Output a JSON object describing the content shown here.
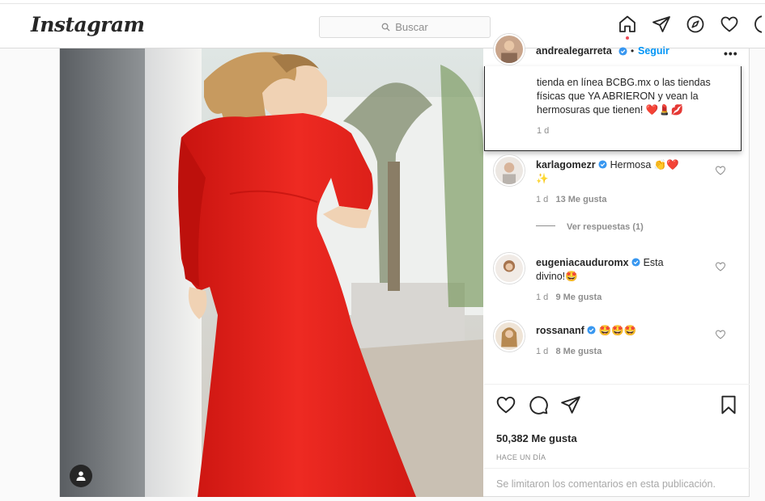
{
  "topbar": {
    "logo": "Instagram",
    "search_placeholder": "Buscar",
    "icons": [
      "home-icon",
      "direct-icon",
      "explore-icon",
      "activity-heart-icon",
      "profile-avatar-icon"
    ]
  },
  "post": {
    "author": "andrealegarreta",
    "follow_label": "Seguir",
    "more_label": "•••",
    "caption_lines": [
      "tienda en línea BCBG.mx o las tiendas",
      "físicas que YA ABRIERON y vean la",
      "hermosuras que tienen! ❤️💄💋"
    ],
    "caption_time": "1 d",
    "comments": [
      {
        "user": "karlagomezr",
        "text": "Hermosa 👏❤️",
        "text2": "✨",
        "time": "1 d",
        "likes": "13 Me gusta"
      },
      {
        "user": "eugeniacauduromx",
        "text": "Esta",
        "text2": "divino!🤩",
        "time": "1 d",
        "likes": "9 Me gusta"
      },
      {
        "user": "rossananf",
        "text": "🤩🤩🤩",
        "text2": "",
        "time": "1 d",
        "likes": "8 Me gusta"
      }
    ],
    "view_replies": "Ver respuestas (1)",
    "likes_count": "50,382 Me gusta",
    "posted_ago": "HACE UN DÍA",
    "comments_disabled": "Se limitaron los comentarios en esta publicación."
  },
  "colors": {
    "dress": "#e8231e",
    "verified": "#3897f0",
    "muted": "#8e8e8e"
  }
}
